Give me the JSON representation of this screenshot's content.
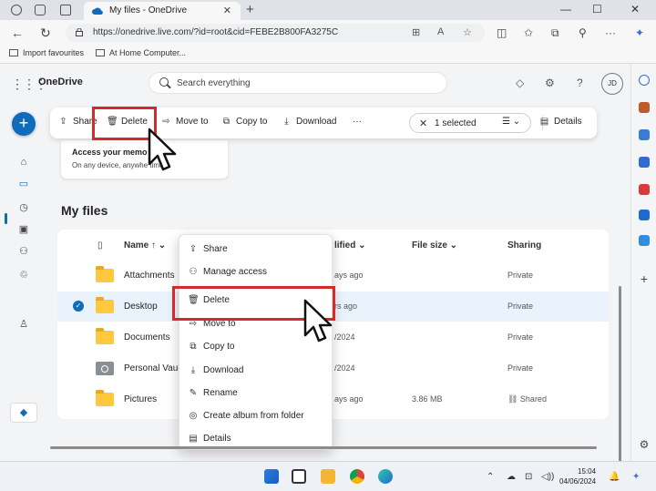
{
  "browser": {
    "tab_title": "My files - OneDrive",
    "tab_close": "✕",
    "new_tab": "+",
    "url": "https://onedrive.live.com/?id=root&cid=FEBE2B800FA3275C",
    "window_controls": [
      "—",
      "☐",
      "✕"
    ],
    "favourites": [
      "Import favourites",
      "At Home Computer..."
    ]
  },
  "app": {
    "brand": "OneDrive",
    "search_placeholder": "Search everything",
    "avatar_initials": "JD",
    "add_button": "+"
  },
  "command_bar": {
    "share": "Share",
    "delete": "Delete",
    "move_to": "Move to",
    "copy_to": "Copy to",
    "download": "Download",
    "more": "···",
    "selected": "1 selected",
    "details": "Details"
  },
  "promo": {
    "heading": "Access your memo",
    "subtext": "On any device, anywhe              time"
  },
  "section_title": "My files",
  "columns": {
    "name": "Name ↑ ⌄",
    "modified": "lified ⌄",
    "size": "File size ⌄",
    "sharing": "Sharing"
  },
  "files": [
    {
      "name": "Attachments",
      "modified": "ays ago",
      "size": "",
      "sharing": "Private",
      "icon": "folder"
    },
    {
      "name": "Desktop",
      "modified": "rs ago",
      "size": "",
      "sharing": "Private",
      "icon": "folder",
      "selected": true
    },
    {
      "name": "Documents",
      "modified": "/2024",
      "size": "",
      "sharing": "Private",
      "icon": "folder"
    },
    {
      "name": "Personal Vault",
      "modified": "/2024",
      "size": "",
      "sharing": "Private",
      "icon": "vault"
    },
    {
      "name": "Pictures",
      "modified": "ays ago",
      "size": "3.86 MB",
      "sharing": "⛓ Shared",
      "icon": "folder"
    }
  ],
  "context_menu": [
    {
      "label": "Share",
      "icon": "share-icon"
    },
    {
      "label": "Manage access",
      "icon": "manage-access-icon"
    },
    {
      "label": "Delete",
      "icon": "delete-icon"
    },
    {
      "label": "Move to",
      "icon": "move-icon"
    },
    {
      "label": "Copy to",
      "icon": "copy-icon"
    },
    {
      "label": "Download",
      "icon": "download-icon"
    },
    {
      "label": "Rename",
      "icon": "rename-icon"
    },
    {
      "label": "Create album from folder",
      "icon": "album-icon"
    },
    {
      "label": "Details",
      "icon": "details-icon"
    }
  ],
  "taskbar": {
    "time": "15:04",
    "date": "04/06/2024"
  },
  "colors": {
    "accent": "#0f6cbd",
    "highlight": "#d42a2a",
    "folder": "#ffc83d"
  }
}
